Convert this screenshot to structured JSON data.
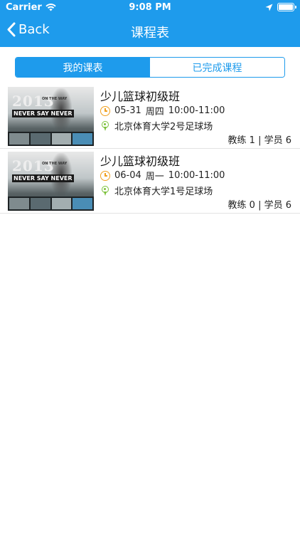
{
  "status_bar": {
    "carrier": "Carrier",
    "time": "9:08 PM"
  },
  "nav": {
    "back_label": "Back",
    "title": "课程表"
  },
  "tabs": [
    {
      "label": "我的课表",
      "active": true
    },
    {
      "label": "已完成课程",
      "active": false
    }
  ],
  "thumbnail": {
    "year": "2013",
    "tagline": "ON THE WAY",
    "banner": "NEVER SAY NEVER"
  },
  "courses": [
    {
      "name": "少儿篮球初级班",
      "date": "05-31",
      "weekday": "周四",
      "time": "10:00-11:00",
      "location": "北京体育大学2号足球场",
      "counts": "教练 1 | 学员 6"
    },
    {
      "name": "少儿篮球初级班",
      "date": "06-04",
      "weekday": "周一",
      "time": "10:00-11:00",
      "location": "北京体育大学1号足球场",
      "counts": "教练 0 | 学员 6"
    }
  ],
  "colors": {
    "accent": "#1e9bec",
    "clock": "#f0a020",
    "pin": "#7cc13c"
  }
}
